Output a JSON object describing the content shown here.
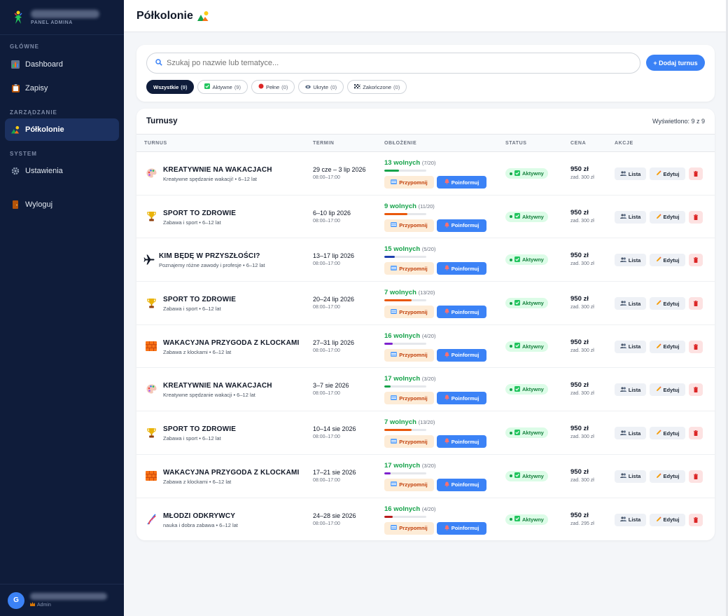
{
  "sidebar": {
    "brand_sub": "PANEL ADMINA",
    "sections": {
      "main": "GŁÓWNE",
      "manage": "ZARZĄDZANIE",
      "system": "SYSTEM"
    },
    "items": {
      "dashboard": "Dashboard",
      "signups": "Zapisy",
      "camps": "Półkolonie",
      "settings": "Ustawienia",
      "logout": "Wyloguj"
    },
    "user_initial": "G",
    "user_role": "Admin"
  },
  "header": {
    "title": "Półkolonie"
  },
  "filters": {
    "search_placeholder": "Szukaj po nazwie lub tematyce...",
    "add_label": "+ Dodaj turnus",
    "chips": [
      {
        "label": "Wszystkie",
        "count": "(9)"
      },
      {
        "label": "Aktywne",
        "count": "(9)"
      },
      {
        "label": "Pełne",
        "count": "(0)"
      },
      {
        "label": "Ukryte",
        "count": "(0)"
      },
      {
        "label": "Zakończone",
        "count": "(0)"
      }
    ]
  },
  "table": {
    "title": "Turnusy",
    "shown": "Wyświetlono: 9 z 9",
    "columns": {
      "turnus": "TURNUS",
      "termin": "TERMIN",
      "oblozenie": "OBŁOŻENIE",
      "status": "STATUS",
      "cena": "CENA",
      "akcje": "AKCJE"
    },
    "actions": {
      "remind": "Przypomnij",
      "inform": "Poinformuj",
      "list": "Lista",
      "edit": "Edytuj"
    },
    "rows": [
      {
        "icon": "palette-icon",
        "name": "KREATYWNIE NA WAKACJACH",
        "sub": "Kreatywne spędzanie wakacji! • 6–12 lat",
        "date": "29 cze – 3 lip 2026",
        "hours": "08:00–17:00",
        "free": "13 wolnych",
        "taken": "(7/20)",
        "fill": 0.35,
        "fill_color": "#16a34a",
        "status": "Aktywny",
        "price": "950 zł",
        "deposit": "zad. 300 zł"
      },
      {
        "icon": "trophy-icon",
        "name": "SPORT TO ZDROWIE",
        "sub": "Zabawa i sport • 6–12 lat",
        "date": "6–10 lip 2026",
        "hours": "08:00–17:00",
        "free": "9 wolnych",
        "taken": "(11/20)",
        "fill": 0.55,
        "fill_color": "#ea580c",
        "status": "Aktywny",
        "price": "950 zł",
        "deposit": "zad. 300 zł"
      },
      {
        "icon": "airplane-icon",
        "name": "KIM BĘDĘ W PRZYSZŁOŚCI?",
        "sub": "Poznajemy różne zawody i profesje • 6–12 lat",
        "date": "13–17 lip 2026",
        "hours": "08:00–17:00",
        "free": "15 wolnych",
        "taken": "(5/20)",
        "fill": 0.25,
        "fill_color": "#1e40af",
        "status": "Aktywny",
        "price": "950 zł",
        "deposit": "zad. 300 zł"
      },
      {
        "icon": "trophy-icon",
        "name": "SPORT TO ZDROWIE",
        "sub": "Zabawa i sport • 6–12 lat",
        "date": "20–24 lip 2026",
        "hours": "08:00–17:00",
        "free": "7 wolnych",
        "taken": "(13/20)",
        "fill": 0.65,
        "fill_color": "#ea580c",
        "status": "Aktywny",
        "price": "950 zł",
        "deposit": "zad. 300 zł"
      },
      {
        "icon": "bricks-icon",
        "name": "WAKACYJNA PRZYGODA Z KLOCKAMI",
        "sub": "Zabawa z klockami • 6–12 lat",
        "date": "27–31 lip 2026",
        "hours": "08:00–17:00",
        "free": "16 wolnych",
        "taken": "(4/20)",
        "fill": 0.2,
        "fill_color": "#7e22ce",
        "status": "Aktywny",
        "price": "950 zł",
        "deposit": "zad. 300 zł"
      },
      {
        "icon": "palette-icon",
        "name": "KREATYWNIE NA WAKACJACH",
        "sub": "Kreatywne spędzanie wakacji • 6–12 lat",
        "date": "3–7 sie 2026",
        "hours": "08:00–17:00",
        "free": "17 wolnych",
        "taken": "(3/20)",
        "fill": 0.15,
        "fill_color": "#16a34a",
        "status": "Aktywny",
        "price": "950 zł",
        "deposit": "zad. 300 zł"
      },
      {
        "icon": "trophy-icon",
        "name": "SPORT TO ZDROWIE",
        "sub": "Zabawa i sport • 6–12 lat",
        "date": "10–14 sie 2026",
        "hours": "08:00–17:00",
        "free": "7 wolnych",
        "taken": "(13/20)",
        "fill": 0.65,
        "fill_color": "#ea580c",
        "status": "Aktywny",
        "price": "950 zł",
        "deposit": "zad. 300 zł"
      },
      {
        "icon": "bricks-icon",
        "name": "WAKACYJNA PRZYGODA Z KLOCKAMI",
        "sub": "Zabawa z klockami • 6–12 lat",
        "date": "17–21 sie 2026",
        "hours": "08:00–17:00",
        "free": "17 wolnych",
        "taken": "(3/20)",
        "fill": 0.15,
        "fill_color": "#7e22ce",
        "status": "Aktywny",
        "price": "950 zł",
        "deposit": "zad. 300 zł"
      },
      {
        "icon": "dna-icon",
        "name": "MŁODZI ODKRYWCY",
        "sub": "nauka i dobra zabawa • 6–12 lat",
        "date": "24–28 sie 2026",
        "hours": "08:00–17:00",
        "free": "16 wolnych",
        "taken": "(4/20)",
        "fill": 0.2,
        "fill_color": "#b91c1c",
        "status": "Aktywny",
        "price": "950 zł",
        "deposit": "zad. 295 zł"
      }
    ]
  }
}
